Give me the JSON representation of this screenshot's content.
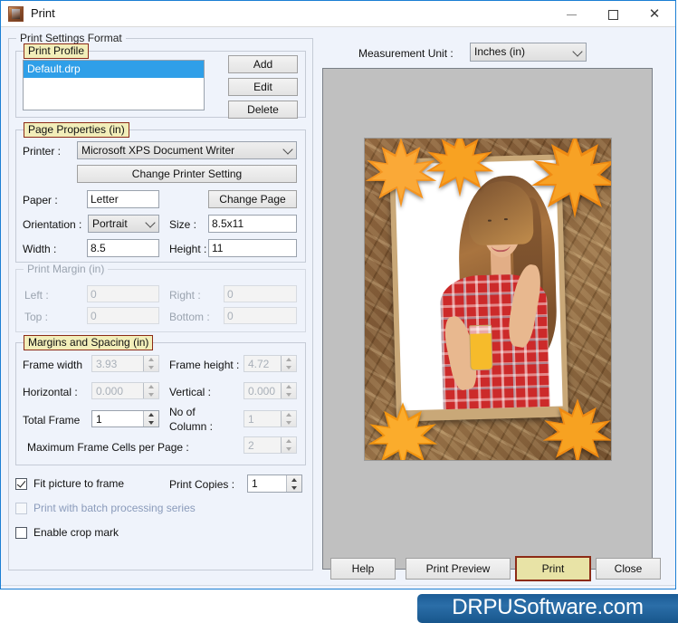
{
  "window": {
    "title": "Print",
    "icon": "photo-frame-icon",
    "buttons": {
      "minimize": "minimize-icon",
      "maximize": "maximize-icon",
      "close": "close-icon"
    }
  },
  "settings_format": {
    "caption": "Print Settings Format"
  },
  "print_profile": {
    "caption": "Print Profile",
    "items": [
      {
        "label": "Default.drp",
        "selected": true
      }
    ],
    "buttons": {
      "add": "Add",
      "edit": "Edit",
      "delete": "Delete"
    }
  },
  "page_properties": {
    "caption": "Page Properties  (in)",
    "printer_label": "Printer :",
    "printer_value": "Microsoft XPS Document Writer",
    "change_printer_setting": "Change Printer Setting",
    "paper_label": "Paper :",
    "paper_value": "Letter",
    "change_page": "Change Page",
    "orientation_label": "Orientation :",
    "orientation_value": "Portrait",
    "size_label": "Size :",
    "size_value": "8.5x11",
    "width_label": "Width :",
    "width_value": "8.5",
    "height_label": "Height :",
    "height_value": "11"
  },
  "print_margin": {
    "caption": "Print Margin  (in)",
    "left_label": "Left :",
    "left_value": "0",
    "right_label": "Right :",
    "right_value": "0",
    "top_label": "Top :",
    "top_value": "0",
    "bottom_label": "Bottom :",
    "bottom_value": "0"
  },
  "margins_spacing": {
    "caption": "Margins and Spacing  (in)",
    "frame_width_label": "Frame width",
    "frame_width_value": "3.93",
    "frame_height_label": "Frame height :",
    "frame_height_value": "4.72",
    "horizontal_label": "Horizontal :",
    "horizontal_value": "0.000",
    "vertical_label": "Vertical :",
    "vertical_value": "0.000",
    "total_frame_label": "Total Frame",
    "total_frame_value": "1",
    "no_of_column_label_line1": "No of",
    "no_of_column_label_line2": "Column :",
    "no_of_column_value": "1",
    "max_cells_label": "Maximum Frame Cells per Page :",
    "max_cells_value": "2"
  },
  "options": {
    "fit_picture_to_frame": "Fit picture to frame",
    "fit_picture_to_frame_checked": true,
    "print_with_batch": "Print with batch processing series",
    "print_with_batch_checked": false,
    "print_with_batch_disabled": true,
    "enable_crop_mark": "Enable crop mark",
    "enable_crop_mark_checked": false,
    "print_copies_label": "Print Copies :",
    "print_copies_value": "1"
  },
  "measurement": {
    "label": "Measurement Unit :",
    "value": "Inches (in)"
  },
  "preview": {
    "name": "print-preview-image",
    "description": "Autumn maple leaves wooden frame with photo of smiling woman in red plaid shirt holding orange juice"
  },
  "bottom_buttons": {
    "help": "Help",
    "print_preview": "Print Preview",
    "print": "Print",
    "close": "Close"
  },
  "watermark": {
    "text": "DRPUSoftware.com"
  },
  "colors": {
    "accent_highlight": "#e8e3a6",
    "accent_border": "#8c2b16",
    "selection": "#2f9fe8",
    "dialog_bg": "#eff3fb",
    "title_border": "#1b7fd4",
    "watermark_bg": "#1b5c96"
  }
}
